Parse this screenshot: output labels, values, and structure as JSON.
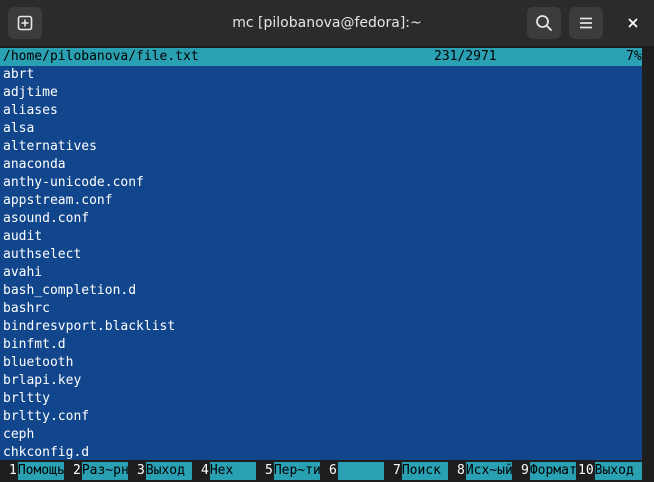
{
  "window": {
    "title": "mc [pilobanova@fedora]:~"
  },
  "toolbar": {
    "new_tab_icon": "new-tab-icon",
    "search_icon": "search-icon",
    "menu_icon": "hamburger-menu-icon",
    "close_label": "✕"
  },
  "viewer": {
    "path": "/home/pilobanova/file.txt",
    "position": "231/2971",
    "percent": "7%",
    "lines": [
      "abrt",
      "adjtime",
      "aliases",
      "alsa",
      "alternatives",
      "anaconda",
      "anthy-unicode.conf",
      "appstream.conf",
      "asound.conf",
      "audit",
      "authselect",
      "avahi",
      "bash_completion.d",
      "bashrc",
      "bindresvport.blacklist",
      "binfmt.d",
      "bluetooth",
      "brlapi.key",
      "brltty",
      "brltty.conf",
      "ceph",
      "chkconfig.d"
    ]
  },
  "fkeys": [
    {
      "num": "1",
      "label": "Помощь"
    },
    {
      "num": "2",
      "label": "Раз~рн"
    },
    {
      "num": "3",
      "label": "Выход"
    },
    {
      "num": "4",
      "label": "Hex"
    },
    {
      "num": "5",
      "label": "Пер~ти"
    },
    {
      "num": "6",
      "label": ""
    },
    {
      "num": "7",
      "label": "Поиск"
    },
    {
      "num": "8",
      "label": "Исх~ый"
    },
    {
      "num": "9",
      "label": "Формат"
    },
    {
      "num": "10",
      "label": "Выход"
    }
  ],
  "colors": {
    "viewer_bg": "#12468c",
    "status_bg": "#2aa1b3",
    "titlebar_bg": "#2b2b2b"
  }
}
